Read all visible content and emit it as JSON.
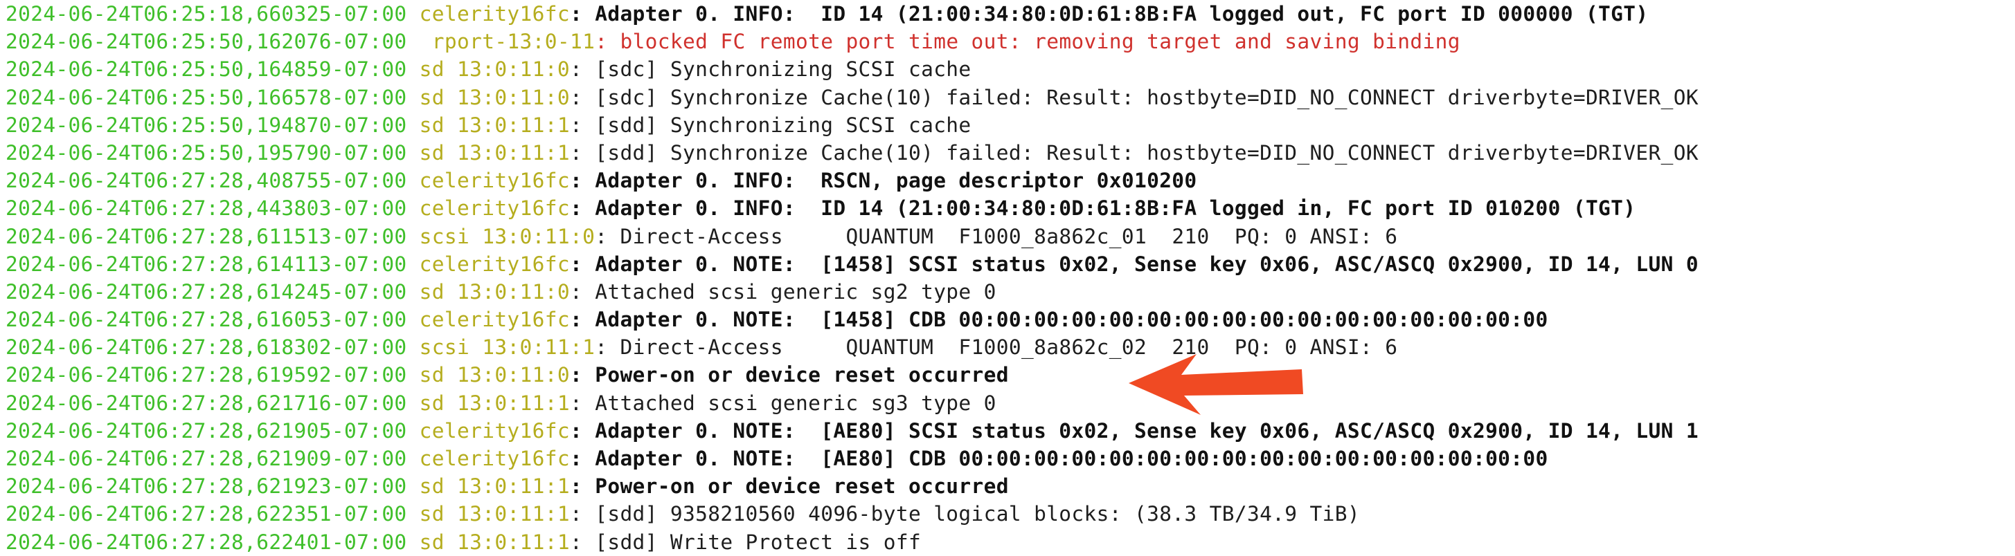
{
  "colors": {
    "timestamp": "#3fbf2a",
    "source": "#b5ad1e",
    "error_text": "#d0312d",
    "arrow": "#f04a23"
  },
  "arrow": {
    "icon": "arrow-left-icon",
    "points_to_line": 14
  },
  "log": [
    {
      "ts": "2024-06-24T06:25:18,660325-07:00",
      "src": " celerity16fc",
      "sep": ": ",
      "msg": "Adapter 0. INFO:  ID 14 (21:00:34:80:0D:61:8B:FA logged out, FC port ID 000000 (TGT)",
      "style": "bold"
    },
    {
      "ts": "2024-06-24T06:25:50,162076-07:00",
      "src": "  rport-13:0-11",
      "sep": ": ",
      "msg": "blocked FC remote port time out: removing target and saving binding",
      "style": "error"
    },
    {
      "ts": "2024-06-24T06:25:50,164859-07:00",
      "src": " sd 13:0:11:0",
      "sep": ": ",
      "msg": "[sdc] Synchronizing SCSI cache",
      "style": "normal"
    },
    {
      "ts": "2024-06-24T06:25:50,166578-07:00",
      "src": " sd 13:0:11:0",
      "sep": ": ",
      "msg": "[sdc] Synchronize Cache(10) failed: Result: hostbyte=DID_NO_CONNECT driverbyte=DRIVER_OK",
      "style": "normal"
    },
    {
      "ts": "2024-06-24T06:25:50,194870-07:00",
      "src": " sd 13:0:11:1",
      "sep": ": ",
      "msg": "[sdd] Synchronizing SCSI cache",
      "style": "normal"
    },
    {
      "ts": "2024-06-24T06:25:50,195790-07:00",
      "src": " sd 13:0:11:1",
      "sep": ": ",
      "msg": "[sdd] Synchronize Cache(10) failed: Result: hostbyte=DID_NO_CONNECT driverbyte=DRIVER_OK",
      "style": "normal"
    },
    {
      "ts": "2024-06-24T06:27:28,408755-07:00",
      "src": " celerity16fc",
      "sep": ": ",
      "msg": "Adapter 0. INFO:  RSCN, page descriptor 0x010200",
      "style": "bold"
    },
    {
      "ts": "2024-06-24T06:27:28,443803-07:00",
      "src": " celerity16fc",
      "sep": ": ",
      "msg": "Adapter 0. INFO:  ID 14 (21:00:34:80:0D:61:8B:FA logged in, FC port ID 010200 (TGT)",
      "style": "bold"
    },
    {
      "ts": "2024-06-24T06:27:28,611513-07:00",
      "src": " scsi 13:0:11:0",
      "sep": ": ",
      "msg": "Direct-Access     QUANTUM  F1000_8a862c_01  210  PQ: 0 ANSI: 6",
      "style": "normal"
    },
    {
      "ts": "2024-06-24T06:27:28,614113-07:00",
      "src": " celerity16fc",
      "sep": ": ",
      "msg": "Adapter 0. NOTE:  [1458] SCSI status 0x02, Sense key 0x06, ASC/ASCQ 0x2900, ID 14, LUN 0",
      "style": "bold"
    },
    {
      "ts": "2024-06-24T06:27:28,614245-07:00",
      "src": " sd 13:0:11:0",
      "sep": ": ",
      "msg": "Attached scsi generic sg2 type 0",
      "style": "normal"
    },
    {
      "ts": "2024-06-24T06:27:28,616053-07:00",
      "src": " celerity16fc",
      "sep": ": ",
      "msg": "Adapter 0. NOTE:  [1458] CDB 00:00:00:00:00:00:00:00:00:00:00:00:00:00:00:00",
      "style": "bold"
    },
    {
      "ts": "2024-06-24T06:27:28,618302-07:00",
      "src": " scsi 13:0:11:1",
      "sep": ": ",
      "msg": "Direct-Access     QUANTUM  F1000_8a862c_02  210  PQ: 0 ANSI: 6",
      "style": "normal"
    },
    {
      "ts": "2024-06-24T06:27:28,619592-07:00",
      "src": " sd 13:0:11:0",
      "sep": ": ",
      "msg": "Power-on or device reset occurred",
      "style": "bold"
    },
    {
      "ts": "2024-06-24T06:27:28,621716-07:00",
      "src": " sd 13:0:11:1",
      "sep": ": ",
      "msg": "Attached scsi generic sg3 type 0",
      "style": "normal"
    },
    {
      "ts": "2024-06-24T06:27:28,621905-07:00",
      "src": " celerity16fc",
      "sep": ": ",
      "msg": "Adapter 0. NOTE:  [AE80] SCSI status 0x02, Sense key 0x06, ASC/ASCQ 0x2900, ID 14, LUN 1",
      "style": "bold"
    },
    {
      "ts": "2024-06-24T06:27:28,621909-07:00",
      "src": " celerity16fc",
      "sep": ": ",
      "msg": "Adapter 0. NOTE:  [AE80] CDB 00:00:00:00:00:00:00:00:00:00:00:00:00:00:00:00",
      "style": "bold"
    },
    {
      "ts": "2024-06-24T06:27:28,621923-07:00",
      "src": " sd 13:0:11:1",
      "sep": ": ",
      "msg": "Power-on or device reset occurred",
      "style": "bold"
    },
    {
      "ts": "2024-06-24T06:27:28,622351-07:00",
      "src": " sd 13:0:11:1",
      "sep": ": ",
      "msg": "[sdd] 9358210560 4096-byte logical blocks: (38.3 TB/34.9 TiB)",
      "style": "normal"
    },
    {
      "ts": "2024-06-24T06:27:28,622401-07:00",
      "src": " sd 13:0:11:1",
      "sep": ": ",
      "msg": "[sdd] Write Protect is off",
      "style": "normal"
    }
  ]
}
